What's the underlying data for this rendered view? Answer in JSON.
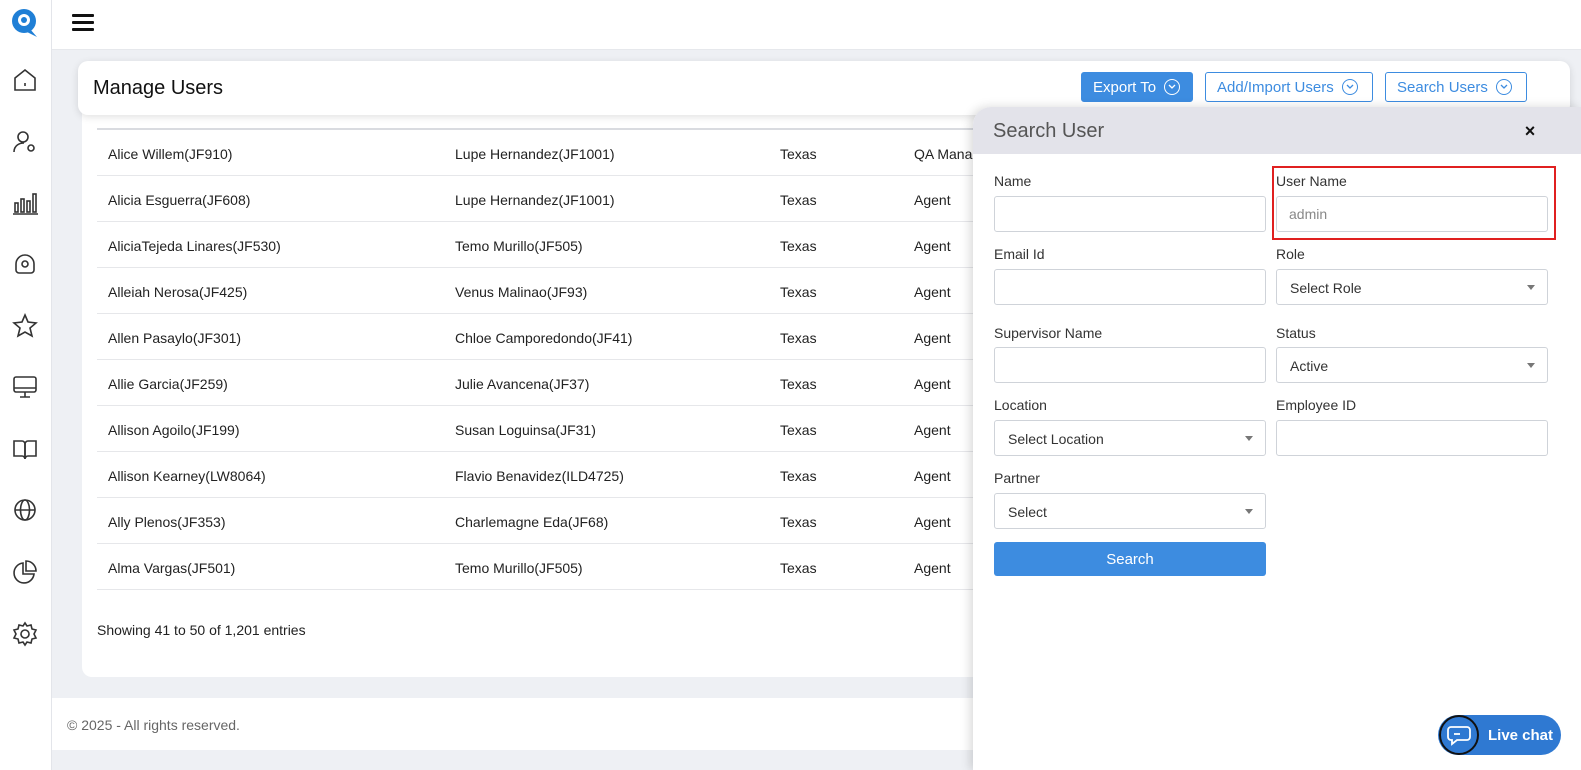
{
  "header": {
    "title": "Manage Users",
    "export_label": "Export To",
    "add_label": "Add/Import Users",
    "search_label": "Search Users"
  },
  "table": {
    "rows": [
      {
        "user": "Alice Willem(JF910)",
        "supervisor": "Lupe Hernandez(JF1001)",
        "location": "Texas",
        "role": "QA Manag"
      },
      {
        "user": "Alicia Esguerra(JF608)",
        "supervisor": "Lupe Hernandez(JF1001)",
        "location": "Texas",
        "role": "Agent"
      },
      {
        "user": "AliciaTejeda Linares(JF530)",
        "supervisor": "Temo Murillo(JF505)",
        "location": "Texas",
        "role": "Agent"
      },
      {
        "user": "Alleiah Nerosa(JF425)",
        "supervisor": "Venus Malinao(JF93)",
        "location": "Texas",
        "role": "Agent"
      },
      {
        "user": "Allen Pasaylo(JF301)",
        "supervisor": "Chloe Camporedondo(JF41)",
        "location": "Texas",
        "role": "Agent"
      },
      {
        "user": "Allie Garcia(JF259)",
        "supervisor": "Julie Avancena(JF37)",
        "location": "Texas",
        "role": "Agent"
      },
      {
        "user": "Allison Agoilo(JF199)",
        "supervisor": "Susan Loguinsa(JF31)",
        "location": "Texas",
        "role": "Agent"
      },
      {
        "user": "Allison Kearney(LW8064)",
        "supervisor": "Flavio Benavidez(ILD4725)",
        "location": "Texas",
        "role": "Agent"
      },
      {
        "user": "Ally Plenos(JF353)",
        "supervisor": "Charlemagne Eda(JF68)",
        "location": "Texas",
        "role": "Agent"
      },
      {
        "user": "Alma Vargas(JF501)",
        "supervisor": "Temo Murillo(JF505)",
        "location": "Texas",
        "role": "Agent"
      }
    ],
    "showing": "Showing 41 to 50 of 1,201 entries"
  },
  "footer": {
    "text": "© 2025 - All rights reserved."
  },
  "panel": {
    "title": "Search User",
    "close": "×",
    "name_label": "Name",
    "username_label": "User Name",
    "username_placeholder": "admin",
    "email_label": "Email Id",
    "role_label": "Role",
    "role_value": "Select Role",
    "supervisor_label": "Supervisor Name",
    "status_label": "Status",
    "status_value": "Active",
    "location_label": "Location",
    "location_value": "Select Location",
    "employee_label": "Employee ID",
    "partner_label": "Partner",
    "partner_value": "Select",
    "search_button": "Search"
  },
  "livechat": {
    "label": "Live chat"
  },
  "colors": {
    "accent": "#3d8ce0",
    "highlight": "#e02020",
    "chat": "#2f79d2"
  }
}
